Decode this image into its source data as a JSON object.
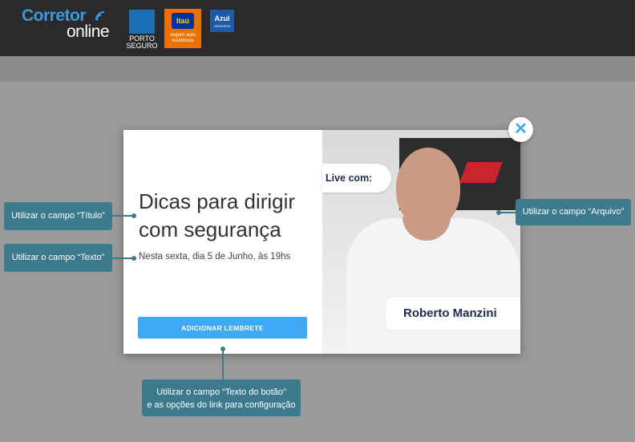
{
  "header": {
    "logo": {
      "word1": "Corretor",
      "word2": "online"
    },
    "partners": {
      "porto": {
        "line1": "PORTO",
        "line2": "SEGURO"
      },
      "itau": {
        "brand": "Itaú",
        "line1": "seguro auto",
        "line2": "residência"
      },
      "azul": {
        "brand": "Azul",
        "sub": "SEGUROS"
      }
    }
  },
  "modal": {
    "title": "Dicas para dirigir com segurança",
    "text": "Nesta sexta, dia 5 de Junho, às 19hs",
    "button_label": "ADICIONAR LEMBRETE",
    "live_label": "Live com:",
    "person_name": "Roberto Manzini",
    "close_symbol": "✕"
  },
  "annotations": {
    "titulo": "Utilizar o campo “Título”",
    "texto": "Utilizar o campo “Texto”",
    "arquivo": "Utilizar o campo “Arquivo”",
    "botao_line1": "Utilizar o campo “Texto do botão”",
    "botao_line2": "e as opções do link para configuração"
  },
  "colors": {
    "accent": "#3fa9f5",
    "annotation": "#3e7a8d",
    "header": "#2a2a2c",
    "overlay": "#9a9a9a"
  },
  "icons": [
    "wifi-icon",
    "close-icon"
  ]
}
